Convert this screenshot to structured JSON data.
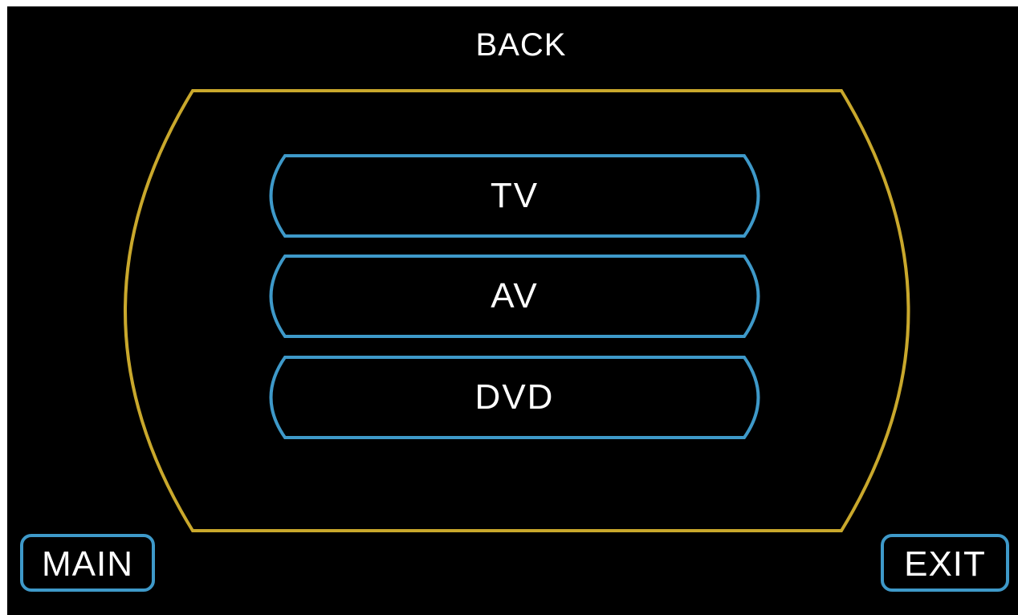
{
  "header": {
    "back_label": "BACK"
  },
  "sources": [
    {
      "label": "TV"
    },
    {
      "label": "AV"
    },
    {
      "label": "DVD"
    }
  ],
  "footer": {
    "main_label": "MAIN",
    "exit_label": "EXIT"
  },
  "colors": {
    "background": "#000000",
    "panel_outline": "#c9a82c",
    "button_outline": "#3e99c9",
    "text": "#ffffff"
  }
}
